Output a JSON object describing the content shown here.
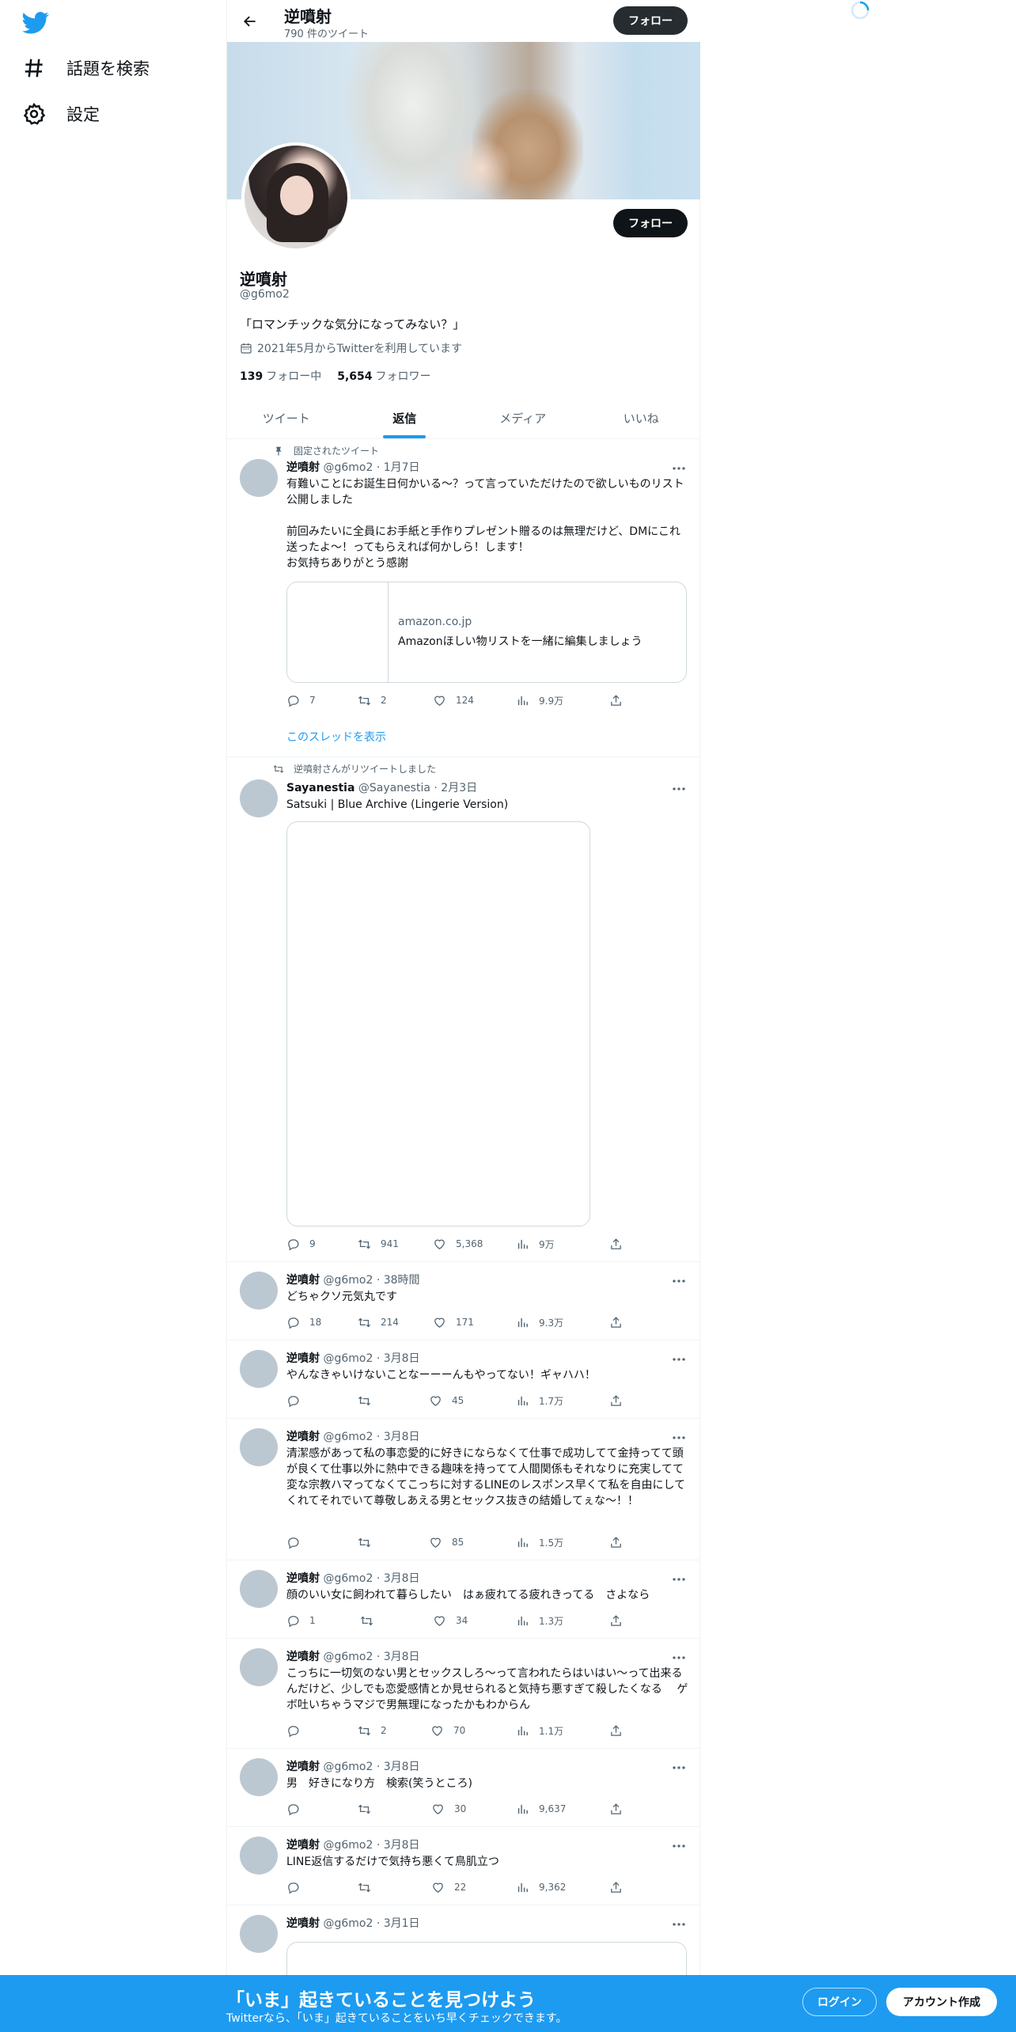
{
  "sidebar": {
    "logo_icon": "twitter-bird-icon",
    "items": [
      {
        "label": "話題を検索",
        "icon": "hashtag-icon"
      },
      {
        "label": "設定",
        "icon": "gear-icon"
      }
    ]
  },
  "header": {
    "name": "逆噴射",
    "tweet_count": "790 件のツイート",
    "follow_label": "フォロー"
  },
  "profile": {
    "name": "逆噴射",
    "handle": "@g6mo2",
    "bio": "「ロマンチックな気分になってみない？」",
    "joined": "2021年5月からTwitterを利用しています",
    "following_count": "139",
    "following_label": "フォロー中",
    "followers_count": "5,654",
    "followers_label": "フォロワー",
    "follow_label": "フォロー"
  },
  "tabs": [
    {
      "label": "ツイート"
    },
    {
      "label": "返信"
    },
    {
      "label": "メディア"
    },
    {
      "label": "いいね"
    }
  ],
  "tweets": [
    {
      "context": "固定されたツイート",
      "name": "逆噴射",
      "handle": "@g6mo2",
      "date": "· 1月7日",
      "text": "有難いことにお誕生日何かいる〜？って言っていただけたので欲しいものリスト公開しました\n\n前回みたいに全員にお手紙と手作りプレゼント贈るのは無理だけど、DMにこれ送ったよ〜！ってもらえれば何かしら！します！\nお気持ちありがとう感謝",
      "card_domain": "amazon.co.jp",
      "card_title": "Amazonほしい物リストを一緒に編集しましょう",
      "replies": "7",
      "retweets": "2",
      "likes": "124",
      "views": "9.9万",
      "show_thread": "このスレッドを表示"
    },
    {
      "context": "逆噴射さんがリツイートしました",
      "name": "Sayanestia",
      "handle": "@Sayanestia",
      "date": "· 2月3日",
      "text": "Satsuki | Blue Archive (Lingerie Version)",
      "replies": "9",
      "retweets": "941",
      "likes": "5,368",
      "views": "9万"
    },
    {
      "name": "逆噴射",
      "handle": "@g6mo2",
      "date": "· 38時間",
      "text": "どちゃクソ元気丸です",
      "replies": "18",
      "retweets": "214",
      "likes": "171",
      "views": "9.3万"
    },
    {
      "name": "逆噴射",
      "handle": "@g6mo2",
      "date": "· 3月8日",
      "text": "やんなきゃいけないことなーーーんもやってない！ギャハハ！",
      "replies": "",
      "retweets": "",
      "likes": "45",
      "views": "1.7万"
    },
    {
      "name": "逆噴射",
      "handle": "@g6mo2",
      "date": "· 3月8日",
      "text": "清潔感があって私の事恋愛的に好きにならなくて仕事で成功してて金持ってて頭が良くて仕事以外に熱中できる趣味を持ってて人間関係もそれなりに充実してて変な宗教ハマってなくてこっちに対するLINEのレスポンス早くて私を自由にしてくれてそれでいて尊敬しあえる男とセックス抜きの結婚してぇな〜！！",
      "replies": "",
      "retweets": "",
      "likes": "85",
      "views": "1.5万"
    },
    {
      "name": "逆噴射",
      "handle": "@g6mo2",
      "date": "· 3月8日",
      "text": "顔のいい女に飼われて暮らしたい　はぁ疲れてる疲れきってる　さよなら",
      "replies": "1",
      "retweets": "",
      "likes": "34",
      "views": "1.3万"
    },
    {
      "name": "逆噴射",
      "handle": "@g6mo2",
      "date": "· 3月8日",
      "text": "こっちに一切気のない男とセックスしろ〜って言われたらはいはい〜って出来るんだけど、少しでも恋愛感情とか見せられると気持ち悪すぎて殺したくなる　 ゲボ吐いちゃうマジで男無理になったかもわからん",
      "replies": "",
      "retweets": "2",
      "likes": "70",
      "views": "1.1万"
    },
    {
      "name": "逆噴射",
      "handle": "@g6mo2",
      "date": "· 3月8日",
      "text": "男　好きになり方　検索(笑うところ)",
      "replies": "",
      "retweets": "",
      "likes": "30",
      "views": "9,637"
    },
    {
      "name": "逆噴射",
      "handle": "@g6mo2",
      "date": "· 3月8日",
      "text": "LINE返信するだけで気持ち悪くて鳥肌立つ",
      "replies": "",
      "retweets": "",
      "likes": "22",
      "views": "9,362"
    },
    {
      "name": "逆噴射",
      "handle": "@g6mo2",
      "date": "· 3月1日",
      "text": ""
    }
  ],
  "bottom_banner": {
    "headline": "「いま」起きていることを見つけよう",
    "subtext": "Twitterなら、「いま」起きていることをいち早くチェックできます。",
    "login_label": "ログイン",
    "signup_label": "アカウント作成"
  },
  "colors": {
    "accent": "#1d9bf0",
    "text": "#0f1419",
    "muted": "#536471",
    "border": "#eff3f4"
  }
}
